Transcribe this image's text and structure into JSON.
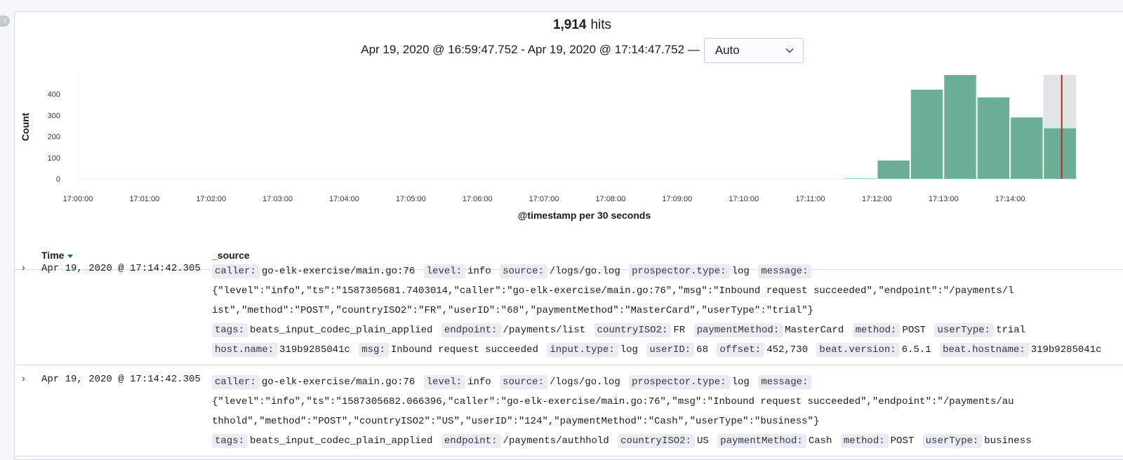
{
  "header": {
    "hits_count": "1,914",
    "hits_label": "hits",
    "time_range": "Apr 19, 2020 @ 16:59:47.752 - Apr 19, 2020 @ 17:14:47.752 —",
    "interval_selected": "Auto"
  },
  "chart_data": {
    "type": "bar",
    "ylabel": "Count",
    "xlabel": "@timestamp per 30 seconds",
    "yticks": [
      "0",
      "100",
      "200",
      "300",
      "400"
    ],
    "xticks": [
      "17:00:00",
      "17:01:00",
      "17:02:00",
      "17:03:00",
      "17:04:00",
      "17:05:00",
      "17:06:00",
      "17:07:00",
      "17:08:00",
      "17:09:00",
      "17:10:00",
      "17:11:00",
      "17:12:00",
      "17:13:00",
      "17:14:00"
    ],
    "ylim": [
      0,
      490
    ],
    "categories": [
      "17:11:30",
      "17:12:00",
      "17:12:30",
      "17:13:00",
      "17:13:30",
      "17:14:00",
      "17:14:30"
    ],
    "values": [
      2,
      86,
      421,
      492,
      384,
      290,
      238
    ],
    "grid": false,
    "bar_color": "#6dae97",
    "marker_color": "#bd271e"
  },
  "table": {
    "col_time": "Time",
    "col_source": "_source",
    "rows": [
      {
        "time": "Apr 19, 2020 @ 17:14:42.305",
        "lead": [
          {
            "k": "caller:",
            "v": "go-elk-exercise/main.go:76"
          },
          {
            "k": "level:",
            "v": "info"
          },
          {
            "k": "source:",
            "v": "/logs/go.log"
          },
          {
            "k": "prospector.type:",
            "v": "log"
          },
          {
            "k": "message:",
            "v": ""
          }
        ],
        "message": "{\"level\":\"info\",\"ts\":\"1587305681.7403014,\"caller\":\"go-elk-exercise/main.go:76\",\"msg\":\"Inbound request succeeded\",\"endpoint\":\"/payments/list\",\"method\":\"POST\",\"countryISO2\":\"FR\",\"userID\":\"68\",\"paymentMethod\":\"MasterCard\",\"userType\":\"trial\"}",
        "tail": [
          {
            "k": "tags:",
            "v": "beats_input_codec_plain_applied"
          },
          {
            "k": "endpoint:",
            "v": "/payments/list"
          },
          {
            "k": "countryISO2:",
            "v": "FR"
          },
          {
            "k": "paymentMethod:",
            "v": "MasterCard"
          },
          {
            "k": "method:",
            "v": "POST"
          },
          {
            "k": "userType:",
            "v": "trial"
          },
          {
            "k": "host.name:",
            "v": "319b9285041c"
          },
          {
            "k": "msg:",
            "v": "Inbound request succeeded"
          },
          {
            "k": "input.type:",
            "v": "log"
          },
          {
            "k": "userID:",
            "v": "68"
          },
          {
            "k": "offset:",
            "v": "452,730"
          },
          {
            "k": "beat.version:",
            "v": "6.5.1"
          },
          {
            "k": "beat.hostname:",
            "v": "319b9285041c"
          }
        ]
      },
      {
        "time": "Apr 19, 2020 @ 17:14:42.305",
        "lead": [
          {
            "k": "caller:",
            "v": "go-elk-exercise/main.go:76"
          },
          {
            "k": "level:",
            "v": "info"
          },
          {
            "k": "source:",
            "v": "/logs/go.log"
          },
          {
            "k": "prospector.type:",
            "v": "log"
          },
          {
            "k": "message:",
            "v": ""
          }
        ],
        "message": "{\"level\":\"info\",\"ts\":\"1587305682.066396,\"caller\":\"go-elk-exercise/main.go:76\",\"msg\":\"Inbound request succeeded\",\"endpoint\":\"/payments/authhold\",\"method\":\"POST\",\"countryISO2\":\"US\",\"userID\":\"124\",\"paymentMethod\":\"Cash\",\"userType\":\"business\"}",
        "tail": [
          {
            "k": "tags:",
            "v": "beats_input_codec_plain_applied"
          },
          {
            "k": "endpoint:",
            "v": "/payments/authhold"
          },
          {
            "k": "countryISO2:",
            "v": "US"
          },
          {
            "k": "paymentMethod:",
            "v": "Cash"
          },
          {
            "k": "method:",
            "v": "POST"
          },
          {
            "k": "userType:",
            "v": "business"
          }
        ]
      }
    ]
  }
}
